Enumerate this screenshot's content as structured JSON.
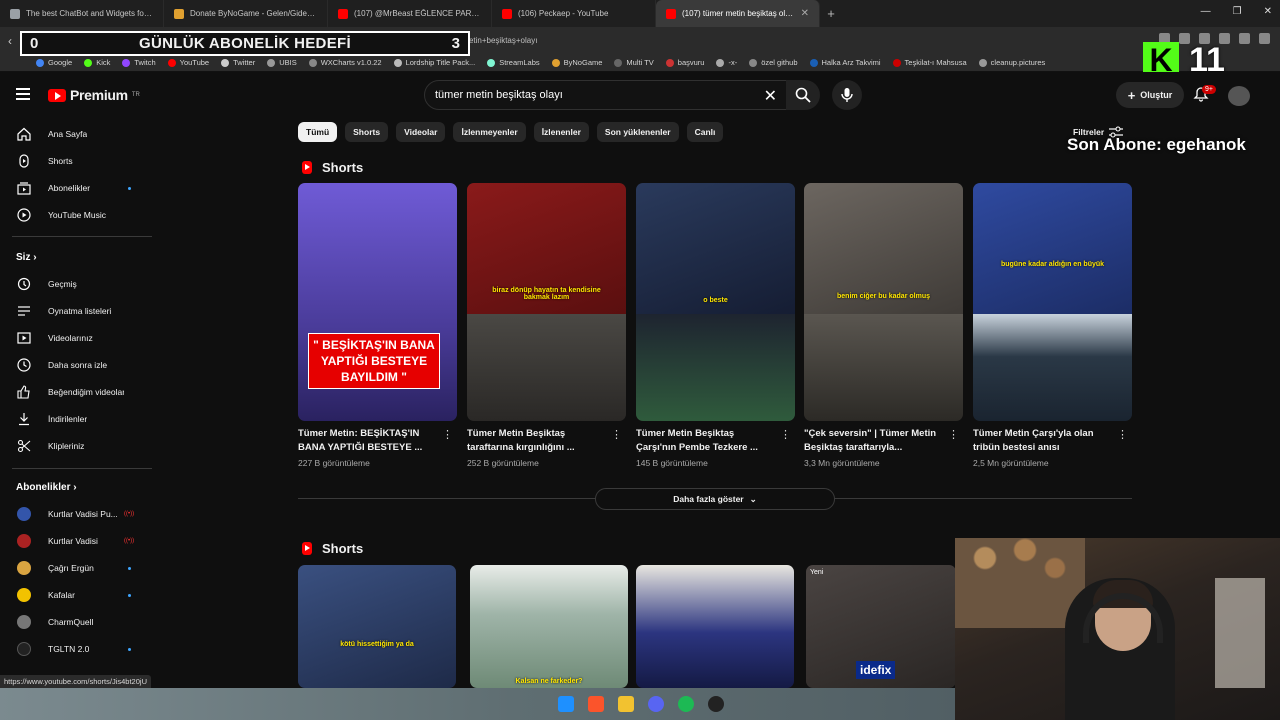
{
  "browser": {
    "tabs": [
      {
        "title": "The best ChatBot and Widgets for Ki",
        "color": "#9aa0a6",
        "active": false
      },
      {
        "title": "Donate ByNoGame - Gelen/Giden Ba",
        "color": "#e0a030",
        "active": false
      },
      {
        "title": "(107) @MrBeast EĞLENCE PARKINDA",
        "color": "#ff0000",
        "active": false
      },
      {
        "title": "(106) Peckaep - YouTube",
        "color": "#ff0000",
        "active": false
      },
      {
        "title": "(107) tümer metin beşiktaş olayı",
        "color": "#ff0000",
        "active": true
      }
    ],
    "url": "results?search_query=tümer+metin+beşiktaş+olayı",
    "bookmarks": [
      {
        "label": "Google",
        "color": "#4285f4"
      },
      {
        "label": "Kick",
        "color": "#53fc18"
      },
      {
        "label": "Twitch",
        "color": "#9146ff"
      },
      {
        "label": "YouTube",
        "color": "#ff0000"
      },
      {
        "label": "Twitter",
        "color": "#cccccc"
      },
      {
        "label": "UBIS",
        "color": "#999999"
      },
      {
        "label": "WXCharts v1.0.22",
        "color": "#888888"
      },
      {
        "label": "Lordship Title Pack...",
        "color": "#bbbbbb"
      },
      {
        "label": "StreamLabs",
        "color": "#80f5d2"
      },
      {
        "label": "ByNoGame",
        "color": "#e0a030"
      },
      {
        "label": "Multi TV",
        "color": "#666666"
      },
      {
        "label": "başvuru",
        "color": "#c33"
      },
      {
        "label": "-x-",
        "color": "#aaaaaa"
      },
      {
        "label": "özel github",
        "color": "#888888"
      },
      {
        "label": "Halka Arz Takvimi",
        "color": "#1a5fb4"
      },
      {
        "label": "Teşkilat-ı Mahsusa",
        "color": "#cc0000"
      },
      {
        "label": "cleanup.pictures",
        "color": "#999999"
      }
    ],
    "status_url": "https://www.youtube.com/shorts/Jis4bt20jU"
  },
  "overlay": {
    "goal_current": "0",
    "goal_label": "GÜNLÜK ABONELİK HEDEFİ",
    "goal_target": "3",
    "kick_count": "11",
    "last_sub": "Son Abone: egehanok"
  },
  "youtube": {
    "brand": "Premium",
    "brand_sup": "TR",
    "search_value": "tümer metin beşiktaş olayı",
    "create_label": "Oluştur",
    "notif_badge": "9+",
    "sidebar": {
      "main": [
        {
          "label": "Ana Sayfa",
          "icon": "home-icon"
        },
        {
          "label": "Shorts",
          "icon": "shorts-icon"
        },
        {
          "label": "Abonelikler",
          "icon": "subscriptions-icon"
        },
        {
          "label": "YouTube Music",
          "icon": "music-icon"
        }
      ],
      "you_heading": "Siz",
      "you": [
        {
          "label": "Geçmiş",
          "icon": "history-icon"
        },
        {
          "label": "Oynatma listeleri",
          "icon": "playlist-icon"
        },
        {
          "label": "Videolarınız",
          "icon": "your-videos-icon"
        },
        {
          "label": "Daha sonra izle",
          "icon": "watch-later-icon"
        },
        {
          "label": "Beğendiğim videolar",
          "icon": "like-icon"
        },
        {
          "label": "İndirilenler",
          "icon": "download-icon"
        },
        {
          "label": "Klipleriniz",
          "icon": "clips-icon"
        }
      ],
      "subs_heading": "Abonelikler",
      "subs": [
        {
          "label": "Kurtlar Vadisi Pu...",
          "color": "#3355aa",
          "live": true
        },
        {
          "label": "Kurtlar Vadisi",
          "color": "#aa2222",
          "live": true
        },
        {
          "label": "Çağrı Ergün",
          "color": "#d9a441",
          "live": false
        },
        {
          "label": "Kafalar",
          "color": "#f2c200",
          "live": false
        },
        {
          "label": "CharmQuell",
          "color": "#777777",
          "live": false
        },
        {
          "label": "TGLTN 2.0",
          "color": "#222222",
          "live": false
        }
      ]
    },
    "chips": [
      "Tümü",
      "Shorts",
      "Videolar",
      "İzlenmeyenler",
      "İzlenenler",
      "Son yüklenenler",
      "Canlı"
    ],
    "filters_label": "Filtreler",
    "section1_title": "Shorts",
    "shorts": [
      {
        "title": "Tümer Metin: BEŞİKTAŞ'IN BANA YAPTIĞI BESTEYE ...",
        "views": "227 B görüntüleme",
        "overlay": "\" BEŞİKTAŞ'IN BANA YAPTIĞI BESTEYE BAYILDIM \"",
        "caption": "",
        "top": "#6f5bd6",
        "bot": "#3b2f7a"
      },
      {
        "title": "Tümer Metin Beşiktaş taraftarına kırgınlığını ...",
        "views": "252 B görüntüleme",
        "overlay": "",
        "caption": "biraz dönüp hayatın ta kendisine bakmak lazım",
        "top": "#7a1414",
        "bot": "#3c3a36"
      },
      {
        "title": "Tümer Metin Beşiktaş Çarşı'nın Pembe Tezkere ...",
        "views": "145 B görüntüleme",
        "overlay": "",
        "caption": "o beste",
        "top": "#1f2a44",
        "bot": "#2d4a3a"
      },
      {
        "title": "\"Çek seversin\" | Tümer Metin Beşiktaş taraftarıyla...",
        "views": "3,3 Mn görüntüleme",
        "overlay": "",
        "caption": "benim ciğer bu kadar olmuş",
        "top": "#5a5550",
        "bot": "#4a4740"
      },
      {
        "title": "Tümer Metin Çarşı'yla olan tribün bestesi anısı",
        "views": "2,5 Mn görüntüleme",
        "overlay": "",
        "caption": "bugüne kadar aldığın en büyük",
        "top": "#2b3f8a",
        "bot": "#334b5c"
      }
    ],
    "more_label": "Daha fazla göster",
    "section2_title": "Shorts",
    "shorts2": [
      {
        "caption": "kötü hissettiğim ya da",
        "color": "#2a3c66"
      },
      {
        "caption": "Kalsan ne farkeder?",
        "color": "#9fb4a8"
      },
      {
        "caption": "",
        "color": "#2c3580"
      },
      {
        "caption": "",
        "color": "#3a3432"
      }
    ],
    "shorts2_badge": "idefix",
    "shorts2_yeni": "Yeni"
  }
}
